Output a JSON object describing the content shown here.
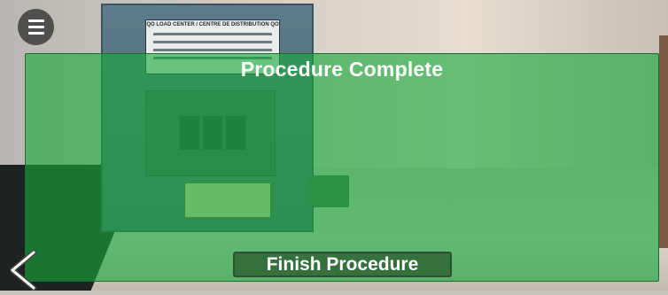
{
  "overlay": {
    "title": "Procedure Complete",
    "color": "#16aa3c"
  },
  "actions": {
    "finish_label": "Finish Procedure"
  },
  "icons": {
    "menu": "hamburger-menu-icon",
    "back": "chevron-left-icon"
  },
  "panel_label": {
    "heading": "QO LOAD CENTER / CENTRE DE DISTRIBUTION QO"
  }
}
